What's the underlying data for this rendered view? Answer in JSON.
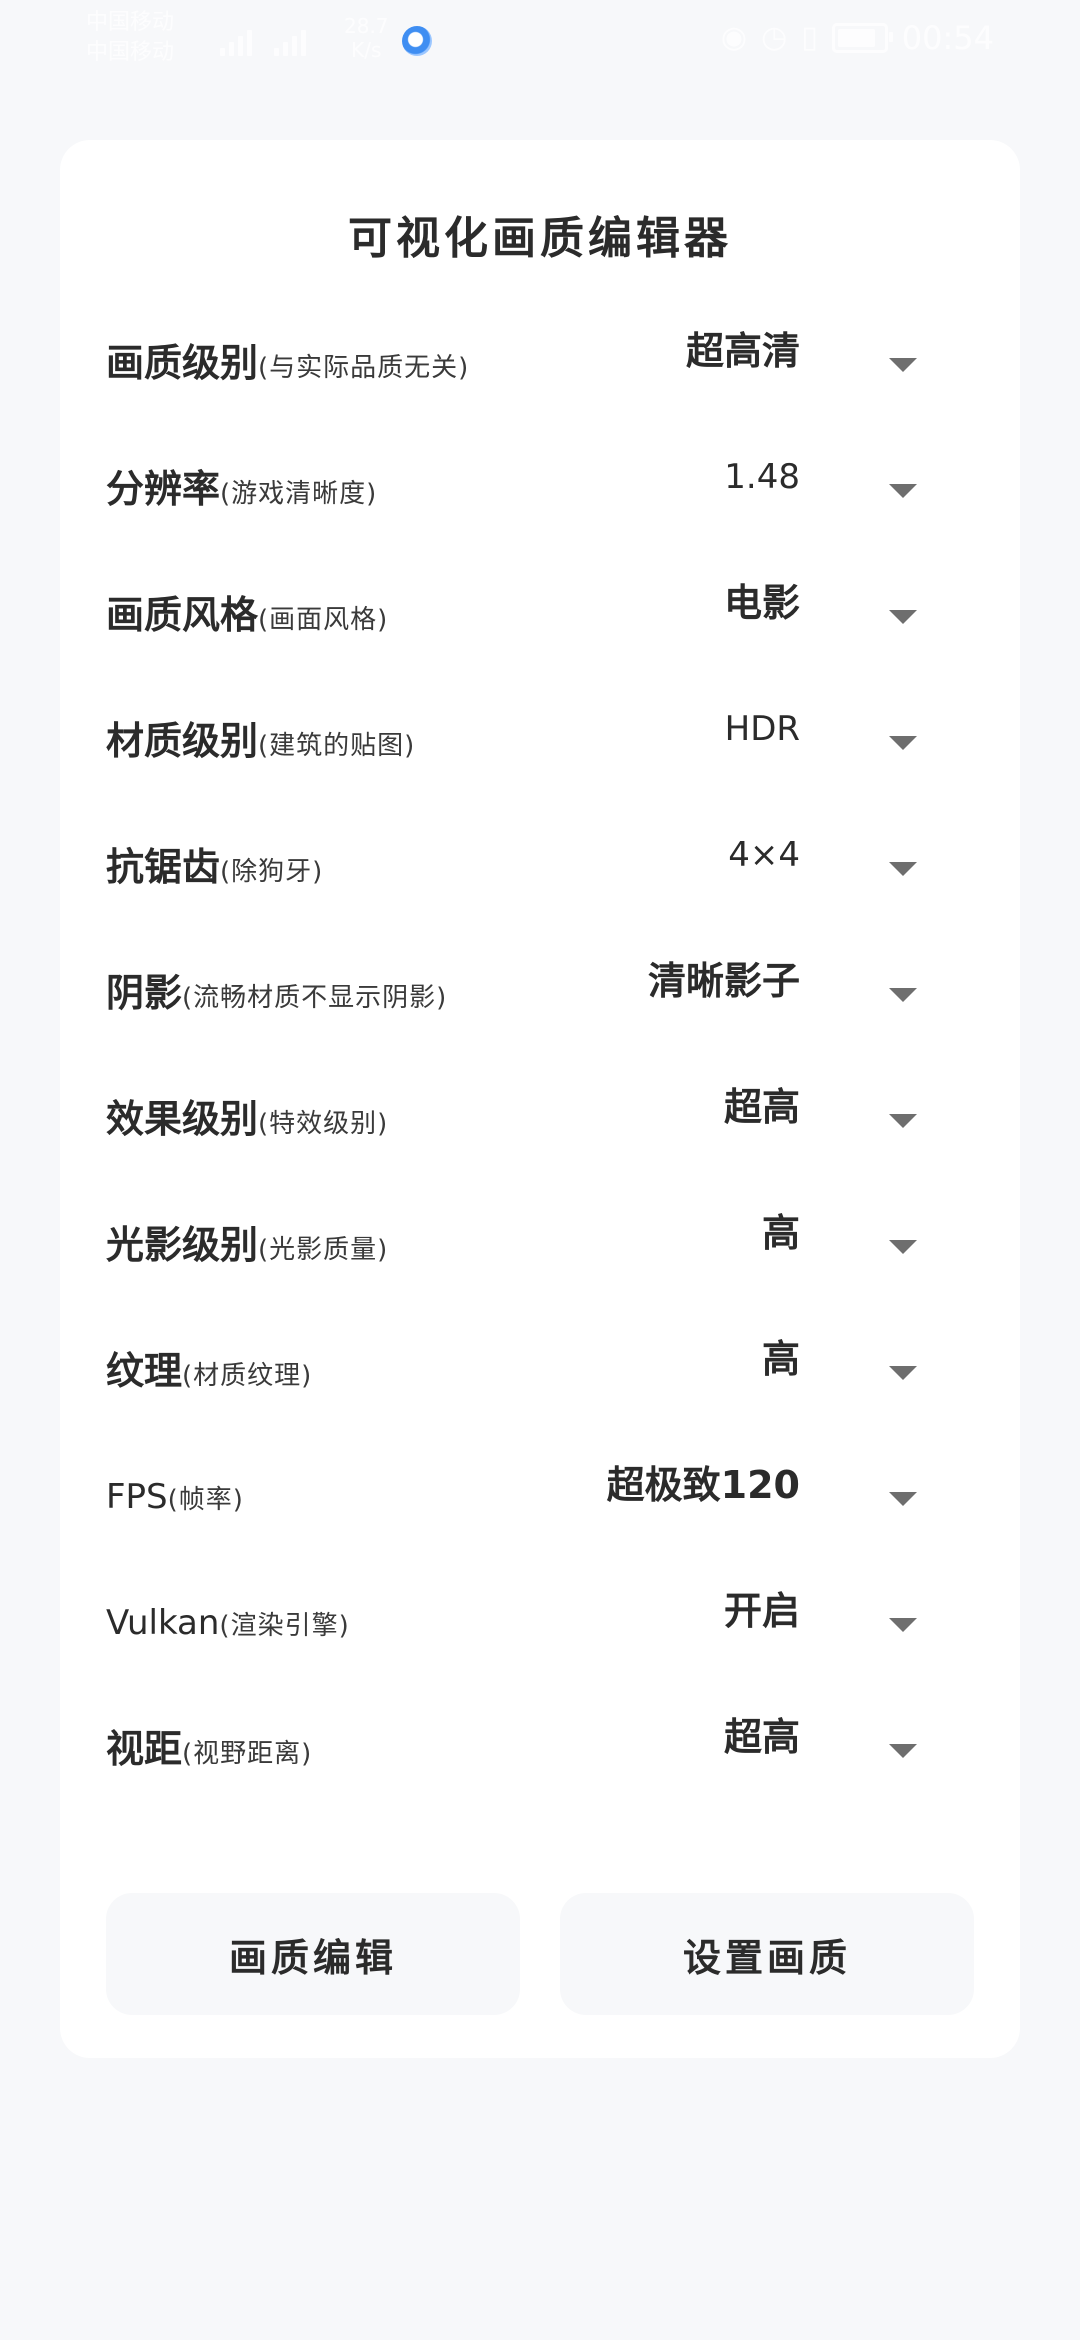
{
  "status_bar": {
    "carrier_1": "中国移动",
    "carrier_2": "中国移动",
    "net_speed_value": "28.7",
    "net_speed_unit": "K/s",
    "time": "00:54",
    "battery_level": 0.85,
    "icons": [
      "signal-icon",
      "eye-icon",
      "alarm-icon",
      "vibrate-icon",
      "battery-icon"
    ]
  },
  "title": "可视化画质编辑器",
  "settings": [
    {
      "label": "画质级别",
      "hint": "(与实际品质无关)",
      "value": "超高清"
    },
    {
      "label": "分辨率",
      "hint": "(游戏清晰度)",
      "value": "1.48"
    },
    {
      "label": "画质风格",
      "hint": "(画面风格)",
      "value": "电影"
    },
    {
      "label": "材质级别",
      "hint": "(建筑的贴图)",
      "value": "HDR"
    },
    {
      "label": "抗锯齿",
      "hint": "(除狗牙)",
      "value": "4×4"
    },
    {
      "label": "阴影",
      "hint": "(流畅材质不显示阴影)",
      "value": "清晰影子"
    },
    {
      "label": "效果级别",
      "hint": "(特效级别)",
      "value": "超高"
    },
    {
      "label": "光影级别",
      "hint": "(光影质量)",
      "value": "高"
    },
    {
      "label": "纹理",
      "hint": "(材质纹理)",
      "value": "高"
    },
    {
      "label": "FPS",
      "hint": "(帧率)",
      "value": "超极致120"
    },
    {
      "label": "Vulkan",
      "hint": "(渲染引擎)",
      "value": "开启"
    },
    {
      "label": "视距",
      "hint": "(视野距离)",
      "value": "超高"
    }
  ],
  "buttons": {
    "edit": "画质编辑",
    "apply": "设置画质"
  },
  "colors": {
    "background": "#f7f8fa",
    "card": "#ffffff",
    "text": "#2b2b2b",
    "arrow": "#6e6e6e"
  }
}
